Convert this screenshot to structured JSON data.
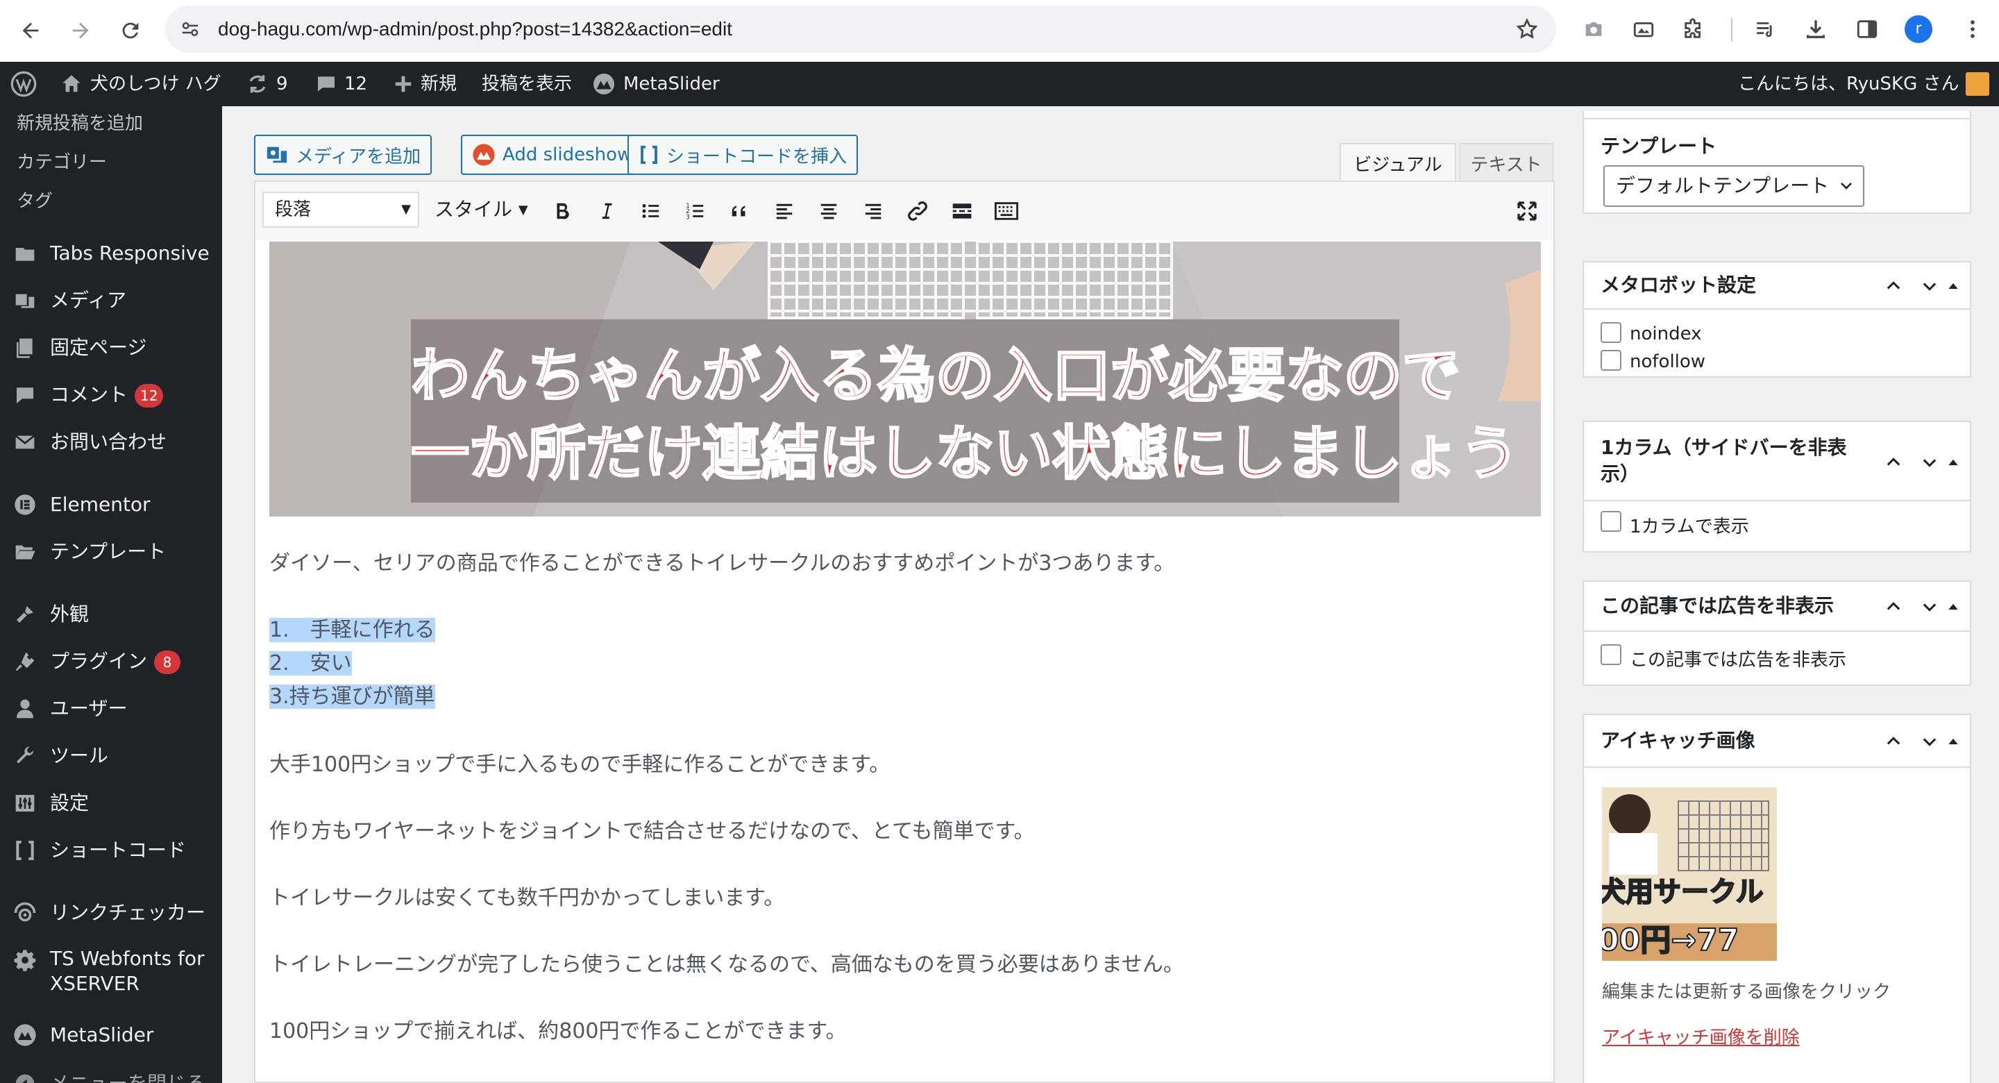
{
  "browser": {
    "url": "dog-hagu.com/wp-admin/post.php?post=14382&action=edit",
    "profile_initial": "r"
  },
  "adminbar": {
    "site_name": "犬のしつけ ハグ",
    "updates_count": "9",
    "comments_count": "12",
    "new_label": "新規",
    "view_post_label": "投稿を表示",
    "metaslider_label": "MetaSlider",
    "greeting": "こんにちは、RyuSKG さん"
  },
  "sidebar": {
    "submenu": [
      "新規投稿を追加",
      "カテゴリー",
      "タグ"
    ],
    "items": [
      {
        "label": "Tabs Responsive",
        "icon": "folder-icon"
      },
      {
        "label": "メディア",
        "icon": "media-icon"
      },
      {
        "label": "固定ページ",
        "icon": "pages-icon"
      },
      {
        "label": "コメント",
        "icon": "comment-icon",
        "badge": "12"
      },
      {
        "label": "お問い合わせ",
        "icon": "mail-icon"
      },
      {
        "label": "Elementor",
        "icon": "elementor-icon"
      },
      {
        "label": "テンプレート",
        "icon": "folder-open-icon"
      },
      {
        "label": "外観",
        "icon": "brush-icon"
      },
      {
        "label": "プラグイン",
        "icon": "plugin-icon",
        "badge": "8"
      },
      {
        "label": "ユーザー",
        "icon": "user-icon"
      },
      {
        "label": "ツール",
        "icon": "wrench-icon"
      },
      {
        "label": "設定",
        "icon": "settings-icon"
      },
      {
        "label": "ショートコード",
        "icon": "bracket-icon"
      },
      {
        "label": "リンクチェッカー",
        "icon": "link-checker-icon"
      },
      {
        "label": "TS Webfonts for",
        "label2": "XSERVER",
        "icon": "gear-icon"
      },
      {
        "label": "MetaSlider",
        "icon": "metaslider-icon"
      },
      {
        "label": "メニューを閉じる",
        "icon": "collapse-icon"
      }
    ]
  },
  "editor": {
    "add_media": "メディアを追加",
    "add_slideshow": "Add slideshow",
    "insert_shortcode": "ショートコードを挿入",
    "tab_visual": "ビジュアル",
    "tab_text": "テキスト",
    "format_select": "段落",
    "style_select": "スタイル",
    "image_caption_line1": "わんちゃんが入る為の入口が必要なので",
    "image_caption_line2": "一か所だけ連結はしない状態にしましょう",
    "paragraphs": {
      "p1": "ダイソー、セリアの商品で作ることができるトイレサークルのおすすめポイントが3つあります。",
      "li1": "1.　手軽に作れる",
      "li2": "2.　安い",
      "li3": "3.持ち運びが簡単",
      "p2": "大手100円ショップで手に入るもので手軽に作ることができます。",
      "p3": "作り方もワイヤーネットをジョイントで結合させるだけなので、とても簡単です。",
      "p4": "トイレサークルは安くても数千円かかってしまいます。",
      "p5": "トイレトレーニングが完了したら使うことは無くなるので、高価なものを買う必要はありません。",
      "p6": "100円ショップで揃えれば、約800円で作ることができます。"
    }
  },
  "right": {
    "template": {
      "title": "テンプレート",
      "selected": "デフォルトテンプレート"
    },
    "meta_robot": {
      "title": "メタロボット設定",
      "opt1": "noindex",
      "opt2": "nofollow"
    },
    "one_column": {
      "title_line1": "1カラム（サイドバーを非表",
      "title_line2": "示）",
      "opt1": "1カラムで表示"
    },
    "hide_ads": {
      "title": "この記事では広告を非表示",
      "opt1": "この記事では広告を非表示"
    },
    "featured": {
      "title": "アイキャッチ画像",
      "thumb_text1": "犬用サークル",
      "thumb_text2": "00円→77",
      "hint": "編集または更新する画像をクリック",
      "remove": "アイキャッチ画像を削除"
    }
  }
}
